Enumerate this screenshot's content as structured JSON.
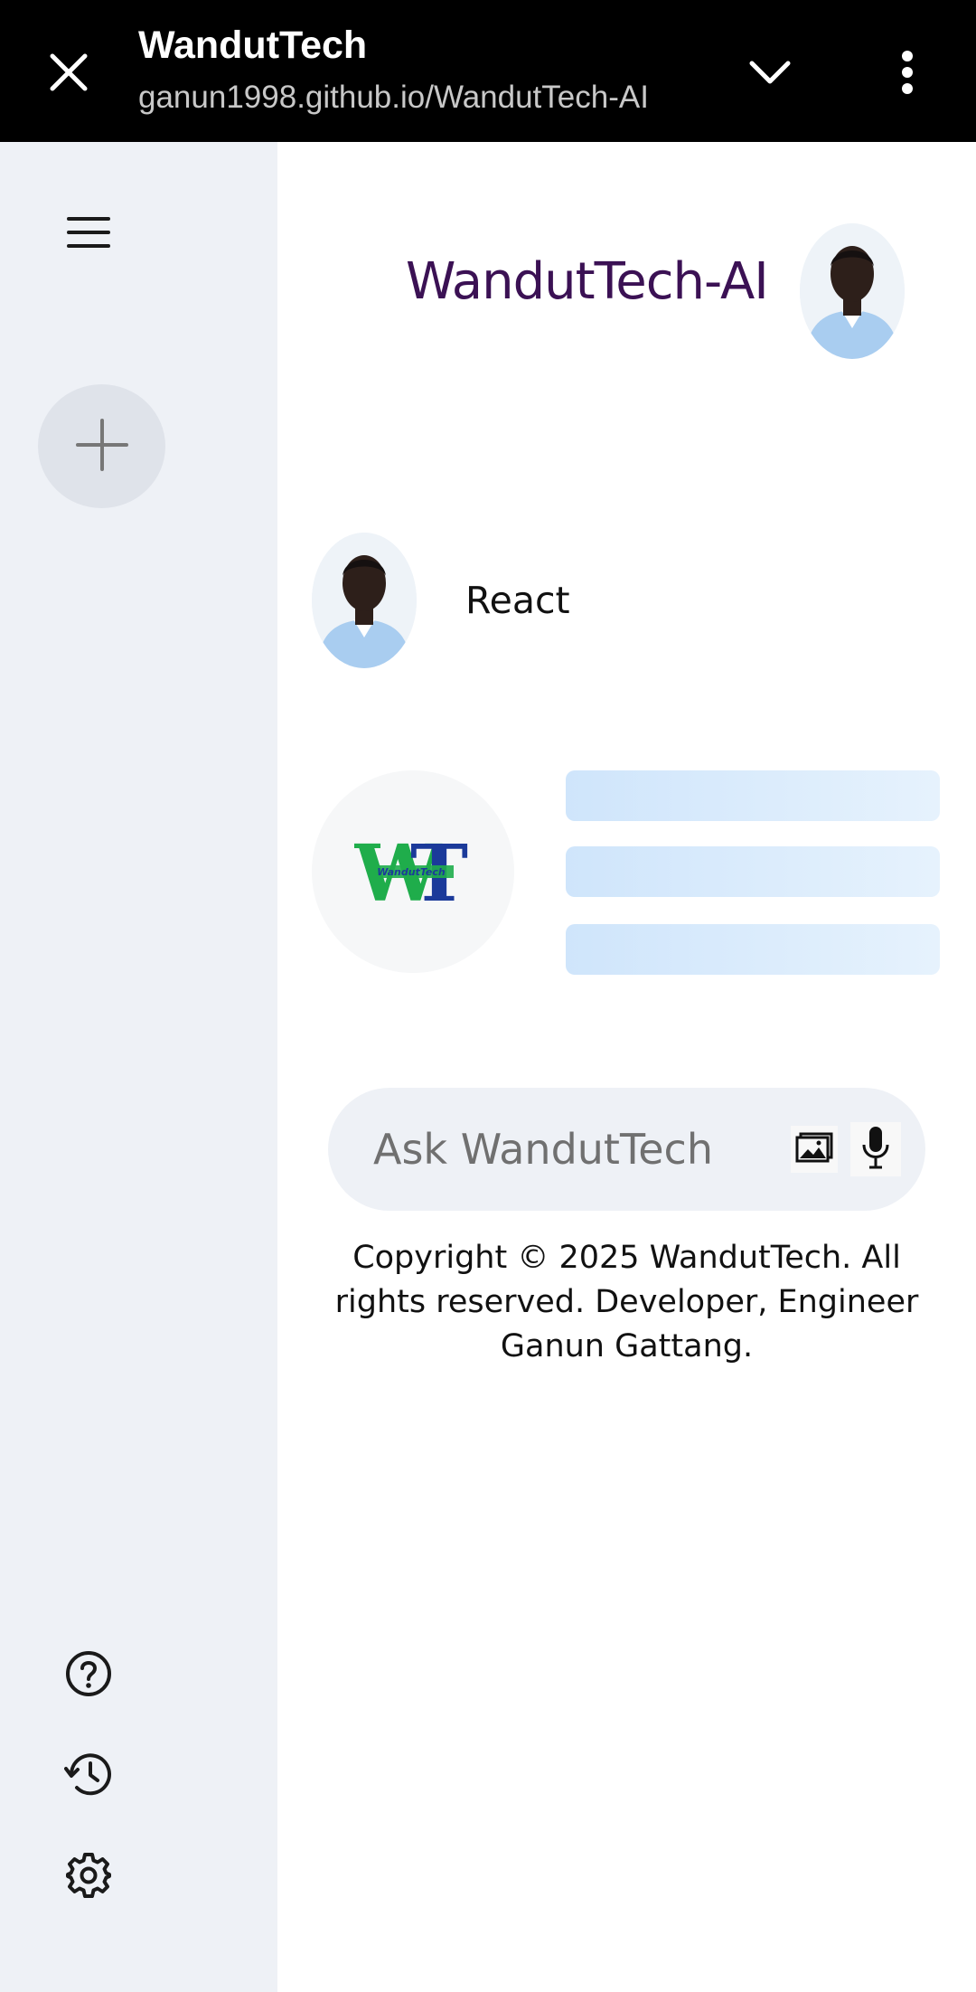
{
  "browser": {
    "title": "WandutTech",
    "url": "ganun1998.github.io/WandutTech-AI",
    "icons": {
      "close": "close-icon",
      "expand": "chevron-down-icon",
      "menu": "more-vertical-icon"
    }
  },
  "sidebar": {
    "icons": {
      "menu": "hamburger-icon",
      "new_chat": "plus-icon",
      "help": "help-icon",
      "history": "history-icon",
      "settings": "gear-icon"
    }
  },
  "header": {
    "app_title": "WandutTech-AI"
  },
  "chat": {
    "user_message": "React",
    "bot_logo_text": "WT",
    "bot_logo_subtext": "WandutTech",
    "loading_lines": 3
  },
  "prompt": {
    "placeholder": "Ask WandutTech",
    "value": ""
  },
  "footer": {
    "copyright": "Copyright © 2025 WandutTech. All rights reserved. Developer, Engineer Ganun Gattang."
  },
  "colors": {
    "topbar_bg": "#000000",
    "sidebar_bg": "#eef1f6",
    "title_color": "#3b1154",
    "logo_green": "#1fad4b",
    "logo_blue": "#1b3a9a",
    "loading_bar": "#cfe5fb"
  }
}
